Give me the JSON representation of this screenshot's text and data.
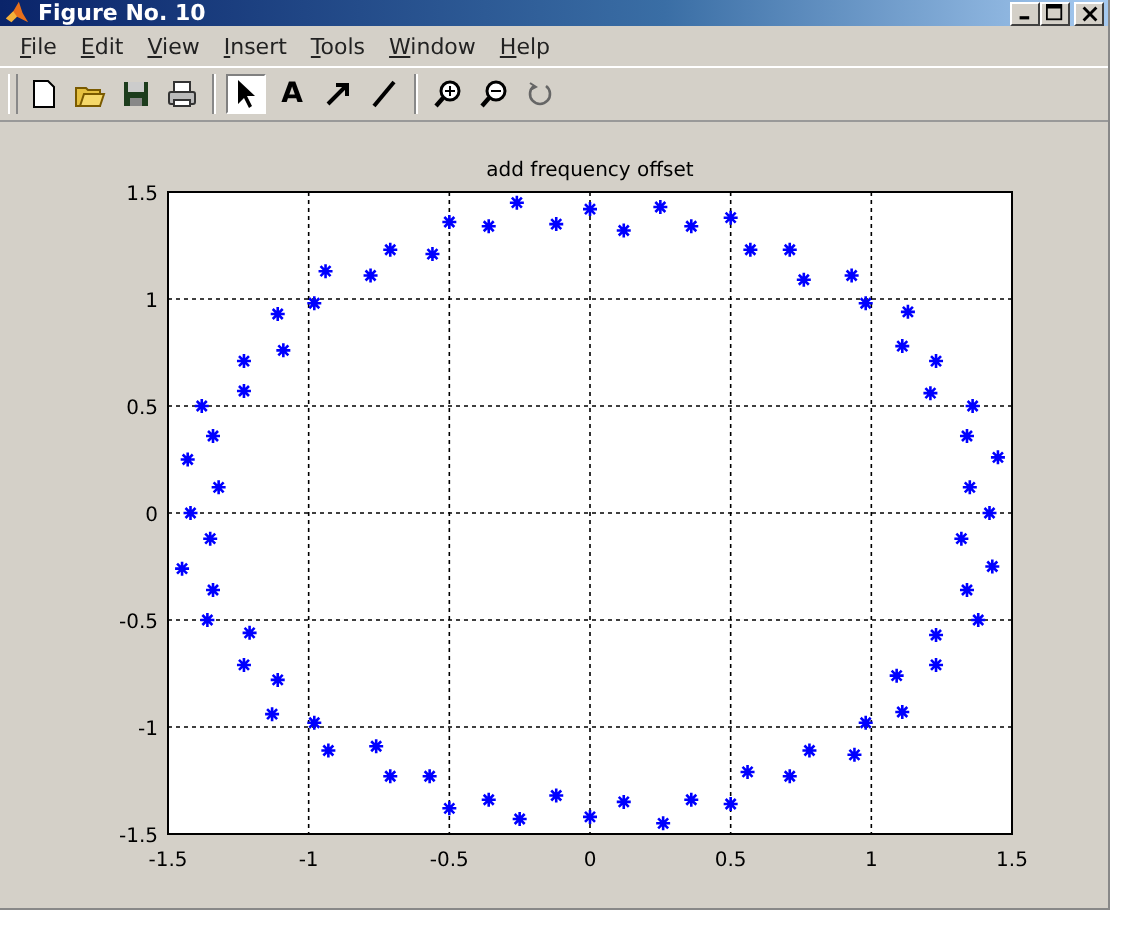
{
  "window": {
    "title": "Figure No. 10"
  },
  "menu": [
    "File",
    "Edit",
    "View",
    "Insert",
    "Tools",
    "Window",
    "Help"
  ],
  "toolbar_groups": [
    [
      {
        "selected": false
      },
      {
        "selected": false
      },
      {
        "selected": false
      },
      {
        "selected": false
      }
    ],
    [
      {
        "selected": true
      },
      {
        "label": "A",
        "selected": false
      },
      {
        "selected": false
      },
      {
        "selected": false
      }
    ],
    [
      {
        "selected": false
      },
      {
        "selected": false
      },
      {
        "selected": false
      }
    ]
  ],
  "chart_data": {
    "type": "scatter",
    "title": "add frequency offset",
    "xlim": [
      -1.5,
      1.5
    ],
    "ylim": [
      -1.5,
      1.5
    ],
    "xticks": [
      -1.5,
      -1,
      -0.5,
      0,
      0.5,
      1,
      1.5
    ],
    "yticks": [
      -1.5,
      -1,
      -0.5,
      0,
      0.5,
      1,
      1.5
    ],
    "grid": true,
    "x": [
      1.42,
      1.35,
      1.45,
      1.34,
      1.36,
      1.21,
      1.23,
      1.11,
      1.13,
      0.98,
      0.93,
      0.76,
      0.71,
      0.57,
      0.5,
      0.36,
      0.25,
      0.12,
      0,
      -0.12,
      -0.26,
      -0.36,
      -0.5,
      -0.56,
      -0.71,
      -0.78,
      -0.94,
      -0.98,
      -1.11,
      -1.09,
      -1.23,
      -1.23,
      -1.38,
      -1.34,
      -1.43,
      -1.32,
      -1.42,
      -1.35,
      -1.45,
      -1.34,
      -1.36,
      -1.21,
      -1.23,
      -1.11,
      -1.13,
      -0.98,
      -0.93,
      -0.76,
      -0.71,
      -0.57,
      -0.5,
      -0.36,
      -0.25,
      -0.12,
      0,
      0.12,
      0.26,
      0.36,
      0.5,
      0.56,
      0.71,
      0.78,
      0.94,
      0.98,
      1.11,
      1.09,
      1.23,
      1.23,
      1.38,
      1.34,
      1.43,
      1.32
    ],
    "series": [
      {
        "color": "#0000ff",
        "values": [
          0,
          0.12,
          0.26,
          0.36,
          0.5,
          0.56,
          0.71,
          0.78,
          0.94,
          0.98,
          1.11,
          1.09,
          1.23,
          1.23,
          1.38,
          1.34,
          1.43,
          1.32,
          1.42,
          1.35,
          1.45,
          1.34,
          1.36,
          1.21,
          1.23,
          1.11,
          1.13,
          0.98,
          0.93,
          0.76,
          0.71,
          0.57,
          0.5,
          0.36,
          0.25,
          0.12,
          0,
          -0.12,
          -0.26,
          -0.36,
          -0.5,
          -0.56,
          -0.71,
          -0.78,
          -0.94,
          -0.98,
          -1.11,
          -1.09,
          -1.23,
          -1.23,
          -1.38,
          -1.34,
          -1.43,
          -1.32,
          -1.42,
          -1.35,
          -1.45,
          -1.34,
          -1.36,
          -1.21,
          -1.23,
          -1.11,
          -1.13,
          -0.98,
          -0.93,
          -0.76,
          -0.71,
          -0.57,
          -0.5,
          -0.36,
          -0.25,
          -0.12
        ]
      }
    ]
  }
}
